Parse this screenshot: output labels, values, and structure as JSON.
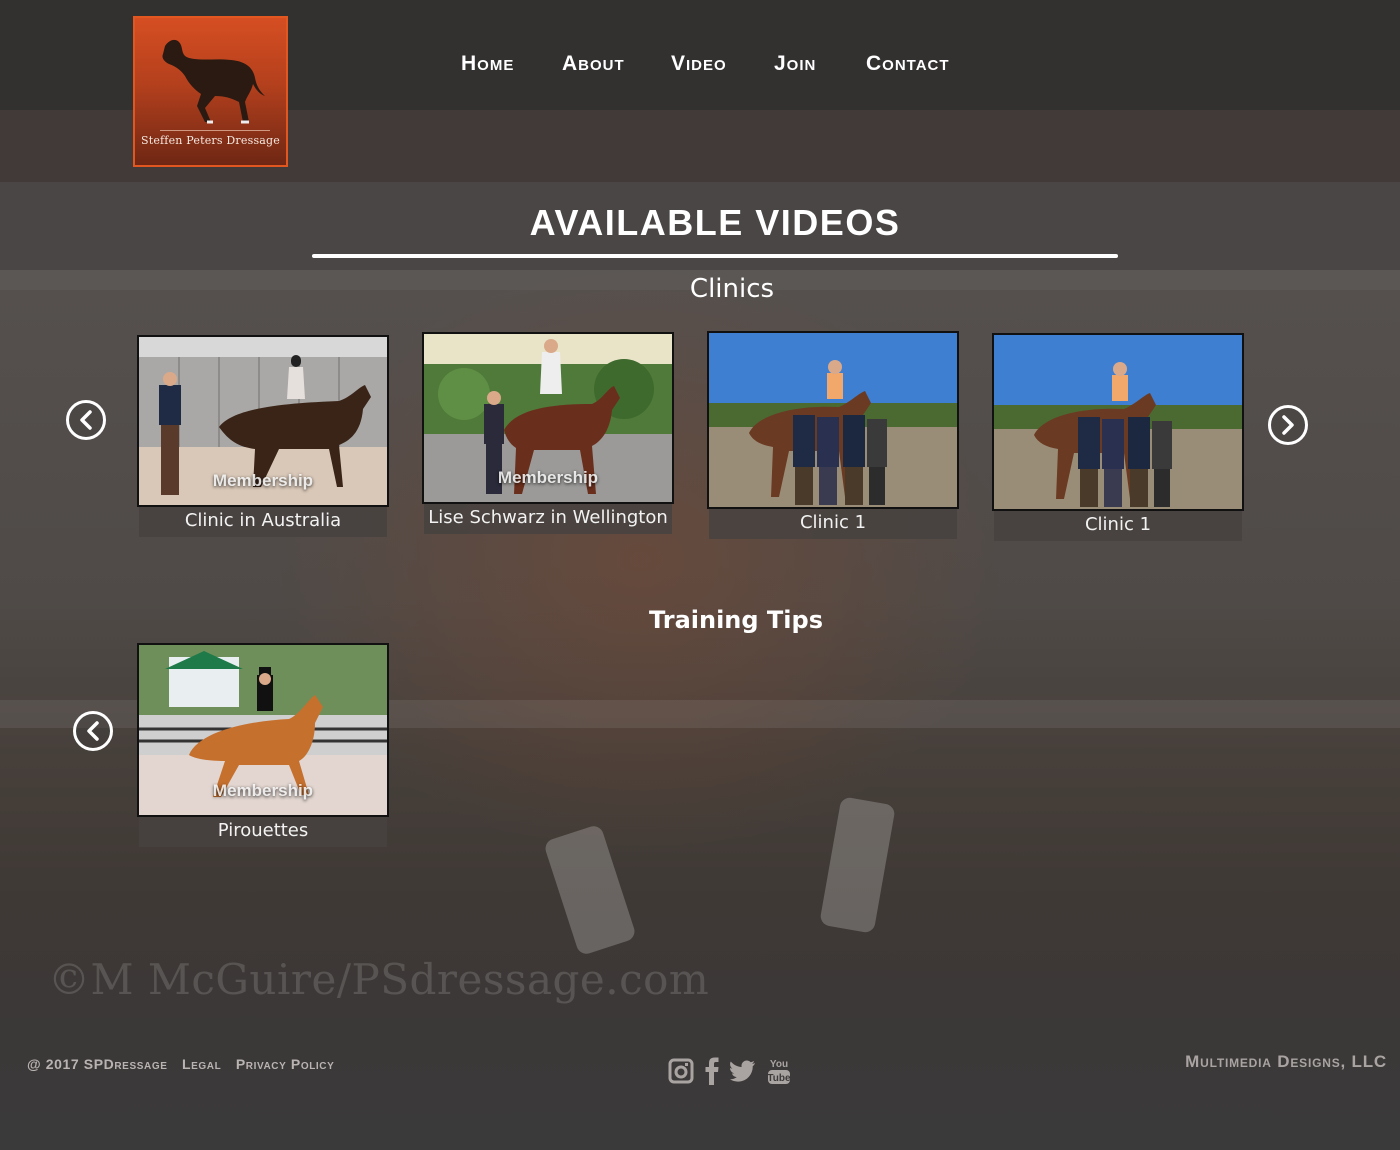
{
  "header": {
    "logo_text": "Steffen Peters Dressage",
    "nav": [
      "Home",
      "About",
      "Video",
      "Join",
      "Contact"
    ]
  },
  "page": {
    "title": "AVAILABLE VIDEOS",
    "watermark": "©M McGuire/PSdressage.com"
  },
  "sections": [
    {
      "title": "Clinics",
      "videos": [
        {
          "caption": "Clinic in Australia",
          "badge": "Membership"
        },
        {
          "caption": "Lise Schwarz in Wellington",
          "badge": "Membership"
        },
        {
          "caption": "Clinic 1",
          "badge": ""
        },
        {
          "caption": "Clinic 1",
          "badge": ""
        }
      ]
    },
    {
      "title": "Training Tips",
      "videos": [
        {
          "caption": "Pirouettes",
          "badge": "Membership"
        }
      ]
    }
  ],
  "footer": {
    "copyright": "@ 2017 SPDressage",
    "legal": "Legal",
    "privacy": "Privacy Policy",
    "credit": "Multimedia Designs, LLC",
    "social_icons": [
      "instagram-icon",
      "facebook-icon",
      "twitter-icon",
      "youtube-icon"
    ]
  },
  "colors": {
    "header_bg": "#333030",
    "logo_border": "#e2571f",
    "logo_bg": "#c2461f"
  }
}
